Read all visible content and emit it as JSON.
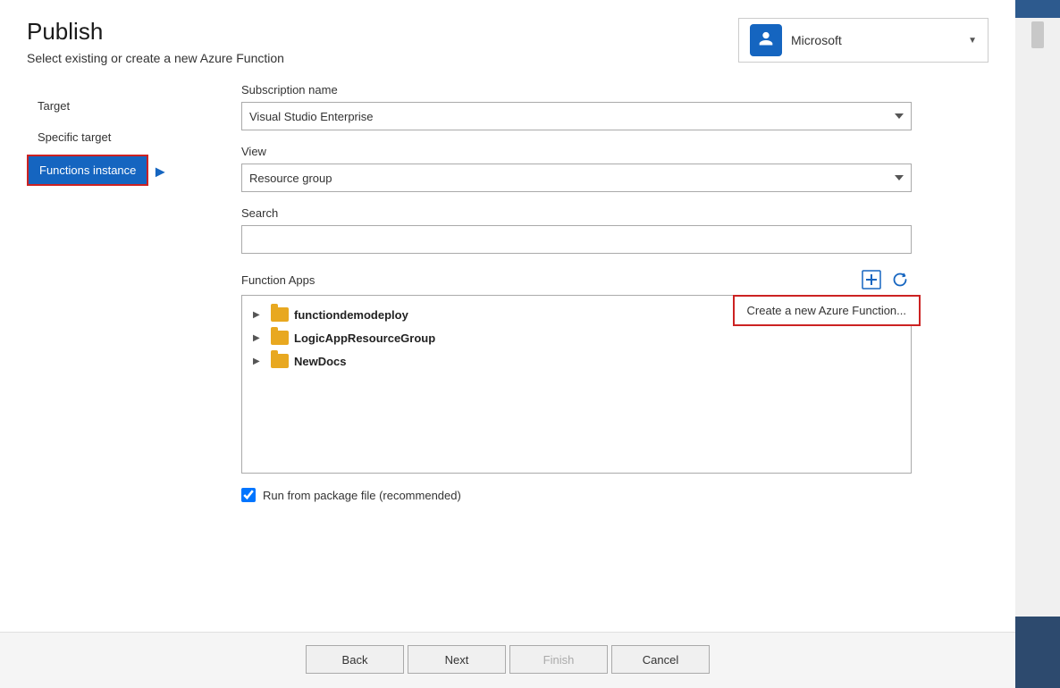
{
  "header": {
    "title": "Publish",
    "subtitle": "Select existing or create a new Azure Function",
    "account": {
      "name": "Microsoft",
      "icon": "👤"
    }
  },
  "nav": {
    "items": [
      {
        "id": "target",
        "label": "Target",
        "active": false
      },
      {
        "id": "specific-target",
        "label": "Specific target",
        "active": false
      },
      {
        "id": "functions-instance",
        "label": "Functions instance",
        "active": true
      }
    ]
  },
  "form": {
    "subscription_label": "Subscription name",
    "subscription_value": "Visual Studio Enterprise",
    "view_label": "View",
    "view_value": "Resource group",
    "search_label": "Search",
    "search_placeholder": "",
    "function_apps_label": "Function Apps",
    "create_tooltip": "Create a new Azure Function...",
    "tree_items": [
      {
        "name": "functiondemodeploy",
        "bold": true
      },
      {
        "name": "LogicAppResourceGroup",
        "bold": true
      },
      {
        "name": "NewDocs",
        "bold": true
      }
    ],
    "checkbox_label": "Run from package file (recommended)",
    "checkbox_checked": true
  },
  "footer": {
    "back_label": "Back",
    "next_label": "Next",
    "finish_label": "Finish",
    "cancel_label": "Cancel"
  },
  "icons": {
    "add": "＋",
    "refresh": "↻",
    "expand": "▶",
    "dropdown": "▼"
  }
}
